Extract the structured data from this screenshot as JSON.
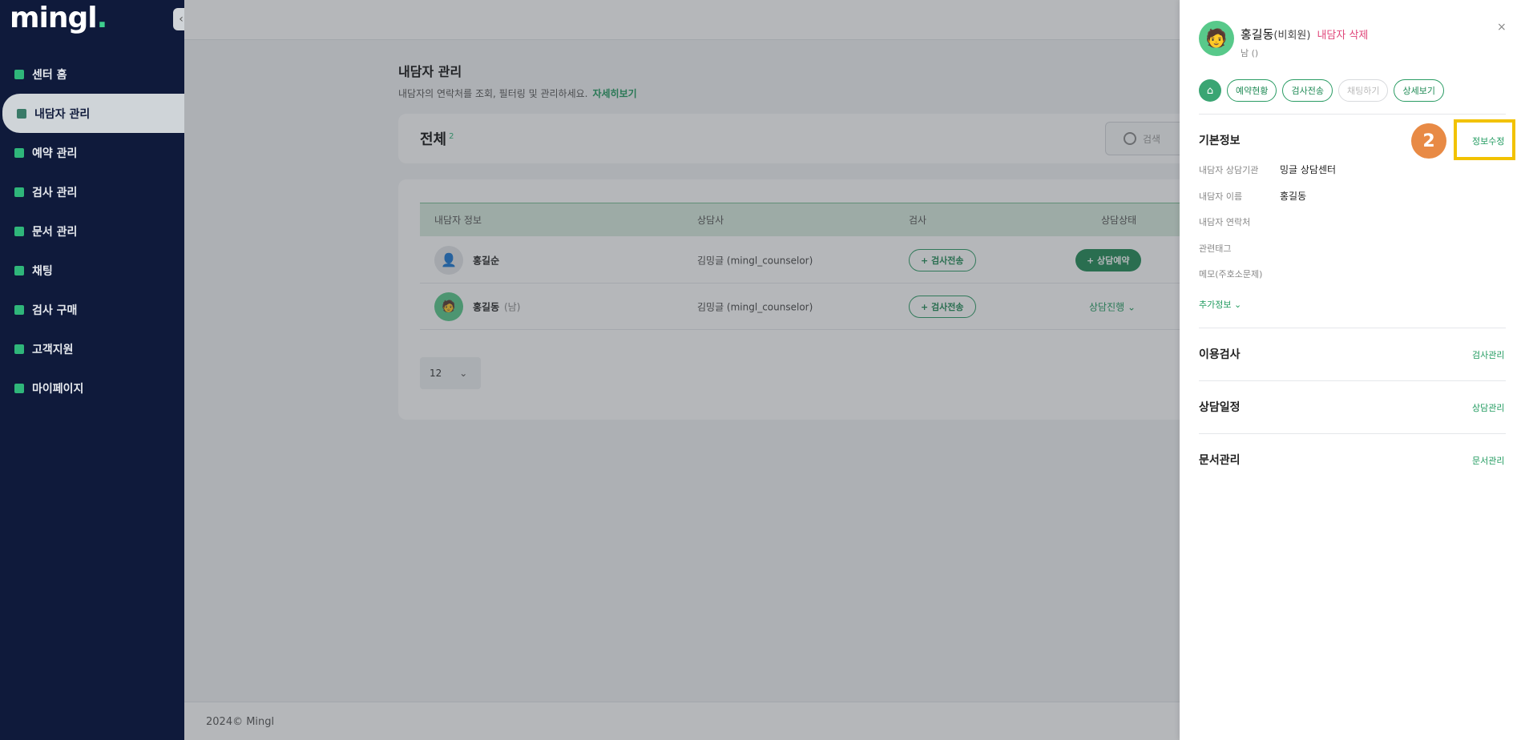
{
  "sidebar": {
    "logo": "mingl",
    "collapse_icon": "‹",
    "items": [
      {
        "label": "센터 홈"
      },
      {
        "label": "내담자 관리",
        "active": true
      },
      {
        "label": "예약 관리"
      },
      {
        "label": "검사 관리"
      },
      {
        "label": "문서 관리"
      },
      {
        "label": "채팅"
      },
      {
        "label": "검사 구매"
      },
      {
        "label": "고객지원"
      },
      {
        "label": "마이페이지"
      }
    ]
  },
  "main": {
    "title": "내담자 관리",
    "subtitle": "내담자의 연락처를 조회, 필터링 및 관리하세요.",
    "subtitle_link": "자세히보기",
    "filter_label": "전체",
    "count": "2",
    "search_placeholder": "검색",
    "table": {
      "headers": [
        "내담자 정보",
        "상담사",
        "검사",
        "상담상태"
      ],
      "rows": [
        {
          "name": "홍길순",
          "gender": "",
          "counselor": "김밍글 (mingl_counselor)",
          "test_btn": "+ 검사전송",
          "status": "+ 상담예약"
        },
        {
          "name": "홍길동",
          "gender": "(남)",
          "counselor": "김밍글 (mingl_counselor)",
          "test_btn": "+ 검사전송",
          "status": "상담진행"
        }
      ]
    },
    "page_size": "12",
    "footer": "2024© Mingl"
  },
  "drawer": {
    "name": "홍길동",
    "member_type": "(비회원)",
    "delete_label": "내담자 삭제",
    "sub": "남 ()",
    "close": "×",
    "actions": [
      "예약현황",
      "검사전송",
      "채팅하기",
      "상세보기"
    ],
    "basic_info": {
      "title": "기본정보",
      "edit_label": "정보수정",
      "fields": [
        {
          "label": "내담자 상담기관",
          "value": "밍글 상담센터"
        },
        {
          "label": "내담자 이름",
          "value": "홍길동"
        },
        {
          "label": "내담자 연락처",
          "value": ""
        },
        {
          "label": "관련태그",
          "value": ""
        },
        {
          "label": "메모(주호소문제)",
          "value": ""
        }
      ],
      "more_label": "추가정보"
    },
    "sections": [
      {
        "title": "이용검사",
        "link": "검사관리"
      },
      {
        "title": "상담일정",
        "link": "상담관리"
      },
      {
        "title": "문서관리",
        "link": "문서관리"
      }
    ],
    "step_badge": "2"
  },
  "colors": {
    "sidebar_bg": "#0f1a3b",
    "accent_green": "#1f8a55",
    "delete_pink": "#e0467a",
    "badge_orange": "#e88a45",
    "highlight_yellow": "#f2c200"
  }
}
